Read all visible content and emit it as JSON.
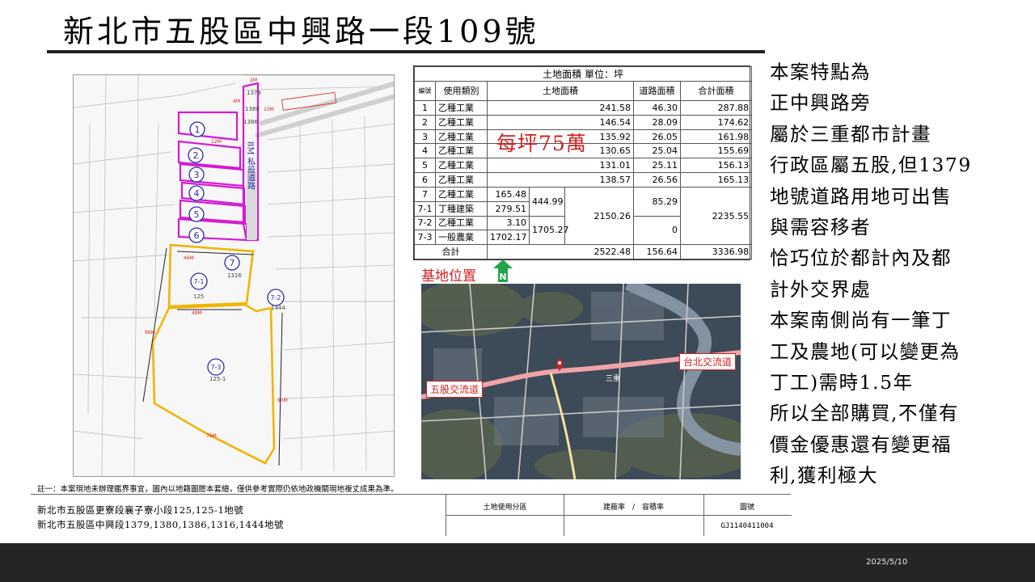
{
  "title": "新北市五股區中興路一段109號",
  "map": {
    "parcels": [
      "1",
      "2",
      "3",
      "4",
      "5",
      "6",
      "7",
      "7-1",
      "7-2",
      "7-3"
    ],
    "road_label": "8M 私設道路",
    "lot_numbers": {
      "p1379": "1379",
      "p1380": "1380",
      "p1386": "1386",
      "p1316": "1316",
      "p125": "125",
      "p1444": "1444",
      "p125_1": "125-1"
    },
    "dims": {
      "d_2m": "2M",
      "d_4m": "4M",
      "d_10m": "10M",
      "d_12m": "12M",
      "d_46m": "46M",
      "d_49m": "49M",
      "d_96m": "96M",
      "d_90m": "90M",
      "d_76m": "76M"
    }
  },
  "land_table": {
    "caption": "土地面積 單位：坪",
    "headers": {
      "no": "編號",
      "use": "使用類別",
      "land": "土地面積",
      "road": "道路面積",
      "total": "合計面積"
    },
    "rows": [
      {
        "no": "1",
        "use": "乙種工業",
        "land": "241.58",
        "road": "46.30",
        "total": "287.88"
      },
      {
        "no": "2",
        "use": "乙種工業",
        "land": "146.54",
        "road": "28.09",
        "total": "174.62"
      },
      {
        "no": "3",
        "use": "乙種工業",
        "land": "135.92",
        "road": "26.05",
        "total": "161.98"
      },
      {
        "no": "4",
        "use": "乙種工業",
        "land": "130.65",
        "road": "25.04",
        "total": "155.69"
      },
      {
        "no": "5",
        "use": "乙種工業",
        "land": "131.01",
        "road": "25.11",
        "total": "156.13"
      },
      {
        "no": "6",
        "use": "乙種工業",
        "land": "138.57",
        "road": "26.56",
        "total": "165.13"
      }
    ],
    "group": {
      "r7": {
        "no": "7",
        "use": "乙種工業",
        "land": "165.48"
      },
      "r71": {
        "no": "7-1",
        "use": "丁種建築",
        "land": "279.51"
      },
      "r72": {
        "no": "7-2",
        "use": "乙種工業",
        "land": "3.10"
      },
      "r73": {
        "no": "7-3",
        "use": "一般農業",
        "land": "1702.17"
      },
      "sub_a": "444.99",
      "sub_b": "1705.27",
      "sum": "2150.26",
      "road_a": "85.29",
      "road_b": "0",
      "total": "2235.55"
    },
    "totals": {
      "label": "合計",
      "land": "2522.48",
      "road": "156.64",
      "total": "3336.98"
    }
  },
  "price_note": "每坪75萬",
  "location": {
    "label": "基地位置",
    "north_icon": "north-arrow-icon",
    "interchange_taipei": "台北交流道",
    "interchange_wugu": "五股交流道",
    "place_sanchong": "三重"
  },
  "notes": [
    "本案特點為",
    "正中興路旁",
    "屬於三重都市計畫",
    "行政區屬五股,但1379",
    "地號道路用地可出售",
    "與需容移者",
    "恰巧位於都計內及都",
    "計外交界處",
    "本案南側尚有一筆丁",
    "工及農地(可以變更為",
    "丁工)需時1.5年",
    "所以全部購買,不僅有",
    "價金優惠還有變更福",
    "利,獲利極大"
  ],
  "footnote": "註一：本案現地未辦理鑑界事宜，圖內以地籍圖謄本套繪，僅供參考實際仍依地政機關現地複丈成果為準。",
  "title_block": {
    "address_1": "新北市五股區更寮段襄子寮小段125,125-1地號",
    "address_2": "新北市五股區中興段1379,1380,1386,1316,1444地號",
    "zoning_label": "土地使用分區",
    "coverage_label": "建蔽率　/　容積率",
    "drawing_label": "圖號",
    "drawing_number": "GJ1140411004"
  },
  "footer": {
    "date": "2025/5/10"
  },
  "colors": {
    "parcel_outline": "#d41ad4",
    "south_outline": "#f0b400",
    "accent_red": "#d42020",
    "footer_bg": "#252525"
  }
}
